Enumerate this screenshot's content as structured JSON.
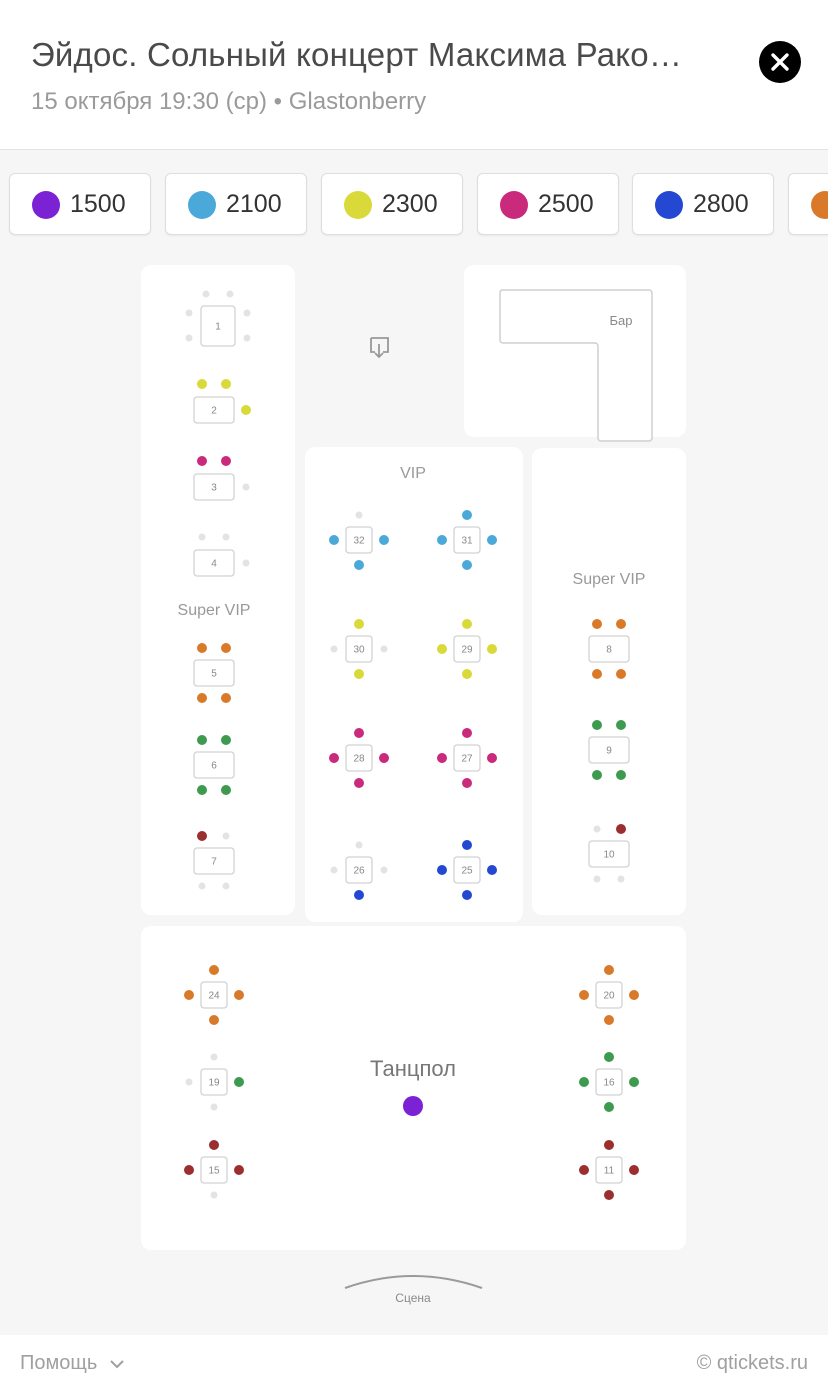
{
  "header": {
    "title": "Эйдос. Сольный концерт Максима Рако…",
    "subtitle": "15 октября 19:30 (ср) • Glastonberry"
  },
  "prices": [
    {
      "label": "1500",
      "color": "#7b22d4"
    },
    {
      "label": "2100",
      "color": "#4aa9d8"
    },
    {
      "label": "2300",
      "color": "#d9d93a"
    },
    {
      "label": "2500",
      "color": "#c92a7c"
    },
    {
      "label": "2800",
      "color": "#2448d1"
    },
    {
      "label": "",
      "color": "#d97a2b"
    }
  ],
  "map": {
    "bar_label": "Бар",
    "vip_label": "VIP",
    "super_vip_left": "Super VIP",
    "super_vip_right": "Super VIP",
    "dance_floor": "Танцпол",
    "stage": "Сцена"
  },
  "tables": [
    {
      "number": "1"
    },
    {
      "number": "2"
    },
    {
      "number": "3"
    },
    {
      "number": "4"
    },
    {
      "number": "5"
    },
    {
      "number": "6"
    },
    {
      "number": "7"
    },
    {
      "number": "32"
    },
    {
      "number": "31"
    },
    {
      "number": "30"
    },
    {
      "number": "29"
    },
    {
      "number": "28"
    },
    {
      "number": "27"
    },
    {
      "number": "26"
    },
    {
      "number": "25"
    },
    {
      "number": "8"
    },
    {
      "number": "9"
    },
    {
      "number": "10"
    },
    {
      "number": "24"
    },
    {
      "number": "19"
    },
    {
      "number": "15"
    },
    {
      "number": "20"
    },
    {
      "number": "16"
    },
    {
      "number": "11"
    }
  ],
  "footer": {
    "help": "Помощь",
    "copyright": "© qtickets.ru"
  }
}
